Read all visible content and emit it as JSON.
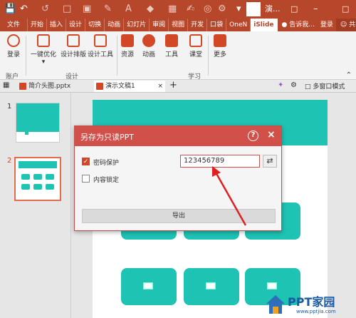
{
  "window": {
    "title": "演..."
  },
  "quick_access": {
    "save": "save-icon",
    "undo": "undo-icon",
    "redo": "redo-icon"
  },
  "ribbon_tabs": [
    "文件",
    "开始",
    "插入",
    "设计",
    "切换",
    "动画",
    "幻灯片",
    "审阅",
    "视图",
    "开发",
    "口袋",
    "OneN",
    "iSlide"
  ],
  "tell_me": "告诉我...",
  "login": "登录",
  "share": "共享",
  "ribbon": {
    "login_btn": "登录",
    "one_click": "一键优化",
    "design_layout": "设计排版",
    "design_tools": "设计工具",
    "resources": "资源",
    "animation": "动画",
    "tools": "工具",
    "course": "课堂",
    "more": "更多",
    "group_account": "账户",
    "group_design": "设计",
    "group_learn": "学习"
  },
  "doc_tabs": [
    {
      "name": "简介头图.pptx"
    },
    {
      "name": "演示文稿1"
    }
  ],
  "add_tab": "+",
  "multi_window": "多窗口模式",
  "slides": [
    {
      "num": "1"
    },
    {
      "num": "2"
    }
  ],
  "dialog": {
    "title": "另存为只读PPT",
    "help": "?",
    "close": "×",
    "password_label": "密码保护",
    "password_value": "123456789",
    "password_checked": true,
    "lock_label": "内容锁定",
    "lock_checked": false,
    "export_label": "导出"
  },
  "watermark": {
    "text": "PPT家园",
    "url": "www.pptjia.com"
  },
  "colors": {
    "accent": "#b7472a",
    "teal": "#1ec3b4",
    "dialog_header": "#d2504a"
  }
}
